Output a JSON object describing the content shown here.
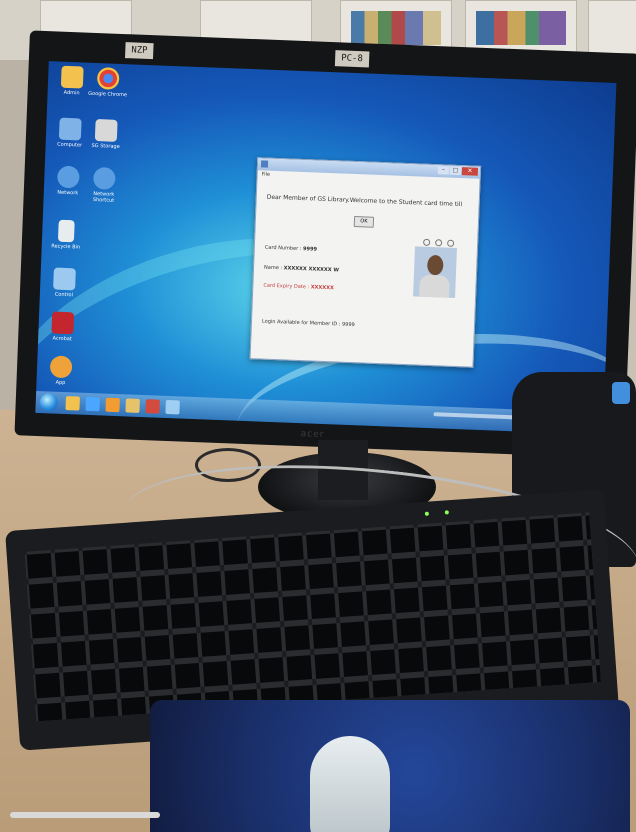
{
  "monitor": {
    "left_label": "NZP",
    "right_label": "PC-8",
    "brand": "acer"
  },
  "desktop_icons": [
    {
      "label": "Admin",
      "icon": "folder-icon",
      "color": "#f2c14e"
    },
    {
      "label": "Google Chrome",
      "icon": "chrome-icon",
      "color": "#e34133"
    },
    {
      "label": "Computer",
      "icon": "computer-icon",
      "color": "#7fb2e6"
    },
    {
      "label": "SG Storage",
      "icon": "drive-icon",
      "color": "#d8d8d8"
    },
    {
      "label": "Network",
      "icon": "network-icon",
      "color": "#5a9de0"
    },
    {
      "label": "Network Shortcut",
      "icon": "network-shortcut-icon",
      "color": "#5a9de0"
    },
    {
      "label": "Recycle Bin",
      "icon": "recycle-bin-icon",
      "color": "#e7ecef"
    },
    {
      "label": "Control",
      "icon": "control-panel-icon",
      "color": "#9bc9ef"
    },
    {
      "label": "Acrobat",
      "icon": "acrobat-icon",
      "color": "#c3262e"
    },
    {
      "label": "App",
      "icon": "app-icon",
      "color": "#f0a23a"
    }
  ],
  "dialog": {
    "title": "",
    "menu": "File",
    "heading": "Dear Member of GS Library.Welcome to the Student card time till",
    "ok_button": "OK",
    "fields": [
      {
        "label": "Card Number :",
        "value": "9999"
      },
      {
        "label": "Name :",
        "value": "XXXXXX XXXXXX W"
      },
      {
        "label": "Card Expiry Date :",
        "value": "XXXXXX",
        "warning": true
      }
    ],
    "footer": "Login Available for Member ID : 9999"
  },
  "taskbar": {
    "icons": [
      {
        "icon": "explorer-icon",
        "color": "#f2c14e"
      },
      {
        "icon": "ie-icon",
        "color": "#4aa6ff"
      },
      {
        "icon": "media-icon",
        "color": "#f39c32"
      },
      {
        "icon": "folder-icon",
        "color": "#e6c26a"
      },
      {
        "icon": "app-icon",
        "color": "#d34a3f"
      },
      {
        "icon": "window-icon",
        "color": "#9ecff2"
      }
    ]
  }
}
